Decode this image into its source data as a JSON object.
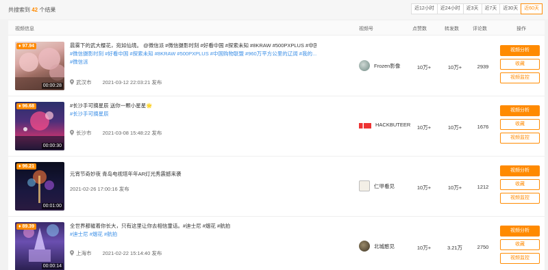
{
  "header": {
    "result_prefix": "共搜索到",
    "result_count": "42",
    "result_suffix": "个结果",
    "time_filters": [
      "近12小时",
      "近24小时",
      "近3天",
      "近7天",
      "近30天",
      "近60天"
    ],
    "active_filter": "近60天"
  },
  "columns": {
    "video_info": "视频信息",
    "channel": "视频号",
    "likes": "点赞数",
    "shares": "转发数",
    "comments": "评论数",
    "actions": "操作"
  },
  "buttons": {
    "analyze": "视频分析",
    "favorite": "收藏",
    "monitor": "视频监控"
  },
  "rows": [
    {
      "score": "97.94",
      "duration": "00:00:28",
      "title": "晨雾下的武大樱花，宛如仙境。 @微信派 #微信摄影时刻 #好看中国 #探索未知 #8KRAW #500PXPLUS #中国购...",
      "tags": "#微信摄影时刻  #好看中国  #探索未知  #8KRAW  #500PXPLUS  #中国购物联盟  #960万平方公里的辽阔  #我的...",
      "tags2": "#微信派",
      "location": "武汉市",
      "publish": "2021-03-12 22:03:21 发布",
      "channel": "Frozen影像",
      "likes": "10万+",
      "shares": "10万+",
      "comments": "2939"
    },
    {
      "score": "96.68",
      "duration": "00:00:30",
      "title": "#长沙手可摘星辰 送你一颗小星星🌟",
      "tags": "#长沙手可摘星辰",
      "tags2": "",
      "location": "长沙市",
      "publish": "2021-03-08 15:48:22 发布",
      "channel": "HACKBUTEER",
      "likes": "10万+",
      "shares": "10万+",
      "comments": "1676"
    },
    {
      "score": "96.21",
      "duration": "00:01:00",
      "title": "元宵节奇妙夜 青岛电视塔年年AR灯光秀震撼来袭",
      "tags": "",
      "tags2": "",
      "location": "",
      "publish": "2021-02-26 17:00:16 发布",
      "channel": "仁甲看见",
      "likes": "10万+",
      "shares": "10万+",
      "comments": "1212"
    },
    {
      "score": "89.39",
      "duration": "00:00:14",
      "title": "全世界都催着你长大，只有这里让你去相信童话。#迪士尼 #烟花 #航拍",
      "tags": "#迪士尼  #烟花  #航拍",
      "tags2": "",
      "location": "上海市",
      "publish": "2021-02-22 15:14:40 发布",
      "channel": "北城憨见",
      "likes": "10万+",
      "shares": "3.21万",
      "comments": "2750"
    }
  ]
}
